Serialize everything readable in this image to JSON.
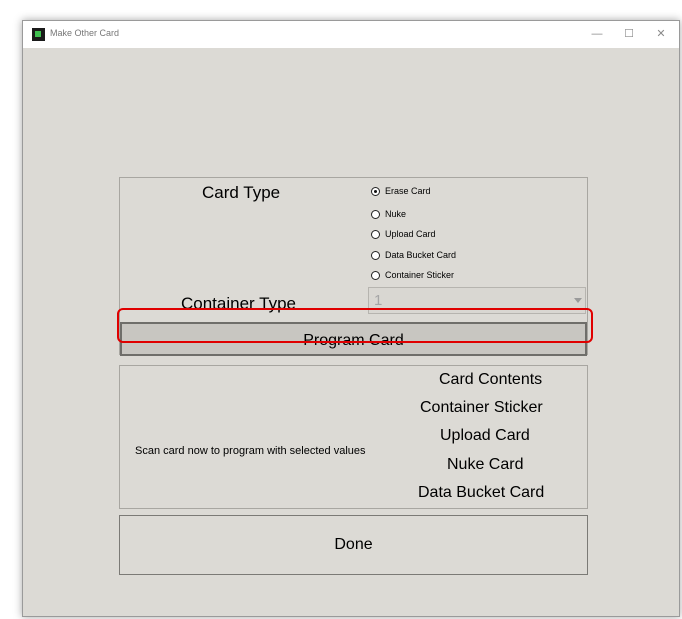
{
  "window": {
    "title": "Make Other Card",
    "minimize_glyph": "—",
    "maximize_glyph": "☐",
    "close_glyph": "✕"
  },
  "card_type": {
    "label": "Card Type",
    "options": [
      {
        "label": "Erase Card",
        "selected": true
      },
      {
        "label": "Nuke",
        "selected": false
      },
      {
        "label": "Upload Card",
        "selected": false
      },
      {
        "label": "Data Bucket Card",
        "selected": false
      },
      {
        "label": "Container Sticker",
        "selected": false
      }
    ]
  },
  "container_type": {
    "label": "Container Type",
    "value": "1"
  },
  "program_button": {
    "label": "Program Card"
  },
  "card_contents": {
    "lines": [
      "Card Contents",
      "Container Sticker",
      "Upload Card",
      "Nuke Card",
      "Data Bucket Card"
    ],
    "status": "Scan card now to program with selected values"
  },
  "done_button": {
    "label": "Done"
  },
  "colors": {
    "window_bg": "#dcdad5",
    "highlight": "#e00000"
  }
}
